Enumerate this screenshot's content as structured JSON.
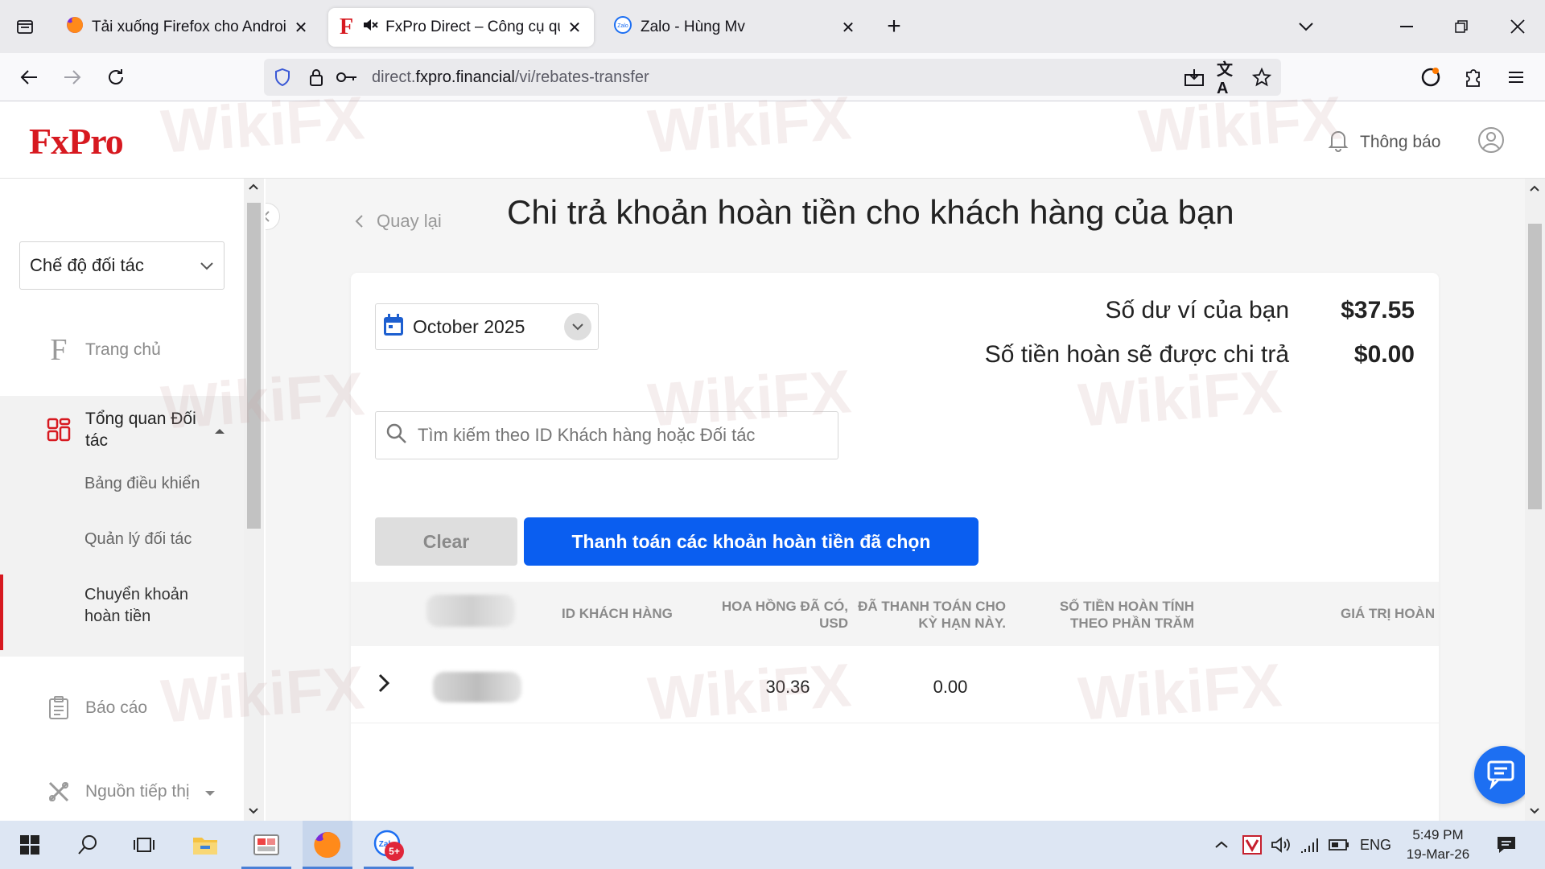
{
  "browser": {
    "tabs": [
      {
        "title": "Tải xuống Firefox cho Android v",
        "active": false
      },
      {
        "title": "FxPro Direct – Công cụ quả",
        "active": true
      },
      {
        "title": "Zalo - Hùng Mv",
        "active": false
      }
    ],
    "url_prefix": "direct.",
    "url_host": "fxpro.financial",
    "url_path": "/vi/rebates-transfer"
  },
  "header": {
    "logo": "FxPro",
    "notifications_label": "Thông báo"
  },
  "sidebar": {
    "mode_select": "Chế độ đối tác",
    "items": [
      {
        "label": "Trang chủ",
        "icon": "fxpro-f-icon"
      },
      {
        "label": "Tổng quan Đối tác",
        "icon": "dashboard-grid-icon"
      },
      {
        "label": "Báo cáo",
        "icon": "report-icon"
      },
      {
        "label": "Nguồn tiếp thị",
        "icon": "marketing-tools-icon"
      }
    ],
    "subitems": [
      {
        "label": "Bảng điều khiển"
      },
      {
        "label": "Quản lý đối tác"
      },
      {
        "label": "Chuyển khoản hoàn tiền",
        "active": true
      }
    ]
  },
  "main": {
    "back_label": "Quay lại",
    "title": "Chi trả khoản hoàn tiền cho khách hàng của bạn",
    "period": "October 2025",
    "wallet_label": "Số dư ví của bạn",
    "wallet_value": "$37.55",
    "payout_label": "Số tiền hoàn sẽ được chi trả",
    "payout_value": "$0.00",
    "search_placeholder": "Tìm kiếm theo ID Khách hàng hoặc Đối tác",
    "clear_label": "Clear",
    "pay_label": "Thanh toán các khoản hoàn tiền đã chọn",
    "table": {
      "columns": [
        "ID KHÁCH HÀNG",
        "HOA HỒNG ĐÃ CÓ, USD",
        "ĐÃ THANH TOÁN CHO KỲ HẠN NÀY.",
        "SỐ TIỀN HOÀN TÍNH THEO PHẦN TRĂM",
        "GIÁ TRỊ HOÀN"
      ],
      "rows": [
        {
          "commission": "30.36",
          "paid": "0.00"
        }
      ]
    }
  },
  "watermark": "WikiFX",
  "taskbar": {
    "language": "ENG",
    "time": "5:49 PM",
    "date": "19-Mar-26",
    "zalo_badge": "5+"
  },
  "colors": {
    "brand_red": "#d71920",
    "primary_blue": "#0a5ef0",
    "accent_blue": "#1d5fd0"
  }
}
